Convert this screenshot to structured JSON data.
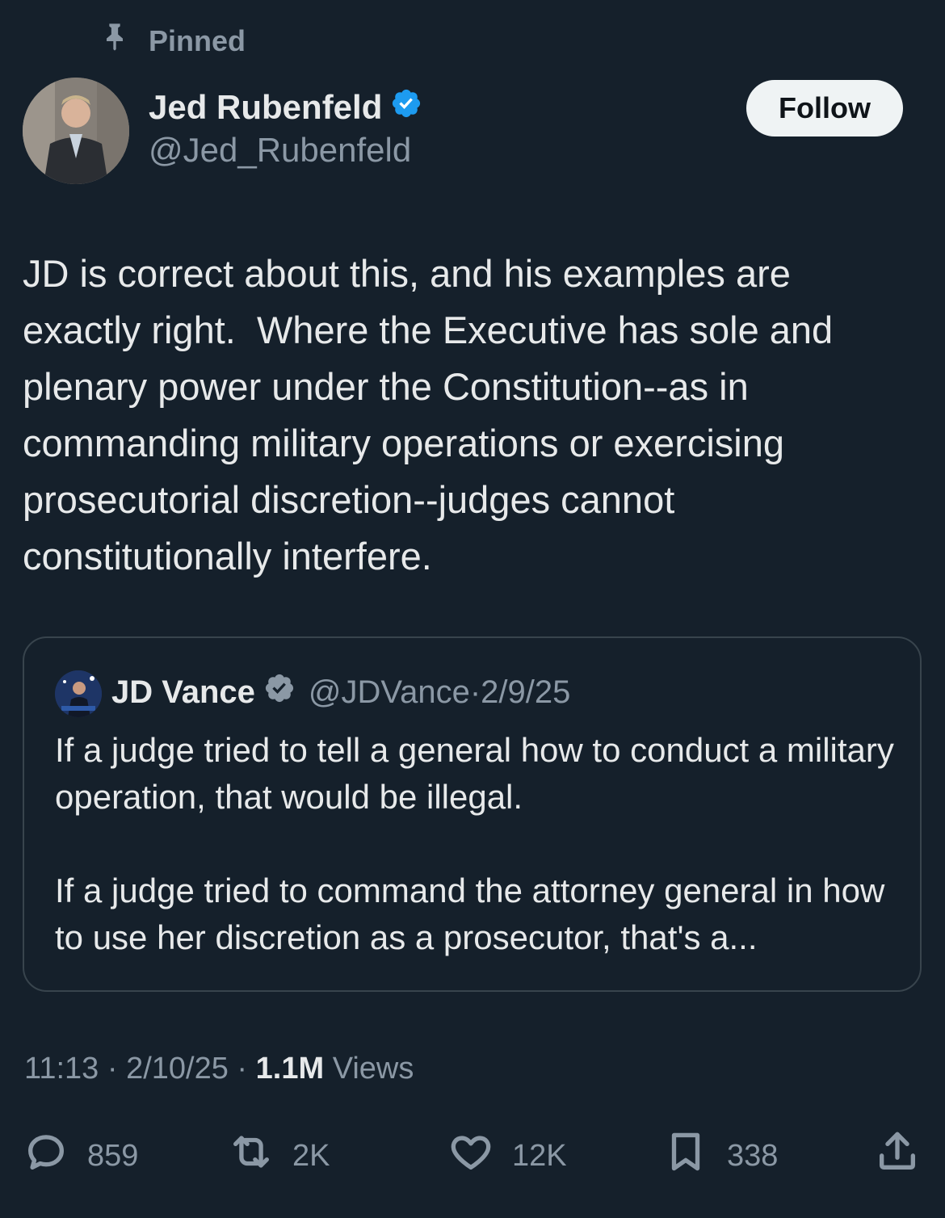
{
  "pinned_label": "Pinned",
  "author": {
    "name": "Jed Rubenfeld",
    "handle": "@Jed_Rubenfeld",
    "verified": true
  },
  "follow_label": "Follow",
  "tweet_text": "JD is correct about this, and his examples are exactly right.  Where the Executive has sole and plenary power under the Constitution--as in commanding military operations or exercising prosecutorial discretion--judges cannot constitutionally interfere.",
  "quote": {
    "name": "JD Vance",
    "handle": "@JDVance",
    "separator": "·",
    "date": "2/9/25",
    "text": "If a judge tried to tell a general how to conduct a military operation, that would be illegal.\n\nIf a judge tried to command the attorney general in how to use her discretion as a prosecutor, that's a..."
  },
  "meta": {
    "time": "11:13",
    "date": "2/10/25",
    "views_count": "1.1M",
    "views_label": "Views",
    "separator": "·"
  },
  "actions": {
    "replies": "859",
    "reposts": "2K",
    "likes": "12K",
    "bookmarks": "338"
  },
  "colors": {
    "background": "#15202b",
    "verified_blue": "#1d9bf0",
    "muted": "#8b98a5"
  },
  "icons": [
    "pin-icon",
    "verified-badge-icon",
    "reply-icon",
    "repost-icon",
    "like-icon",
    "bookmark-icon",
    "share-icon"
  ]
}
